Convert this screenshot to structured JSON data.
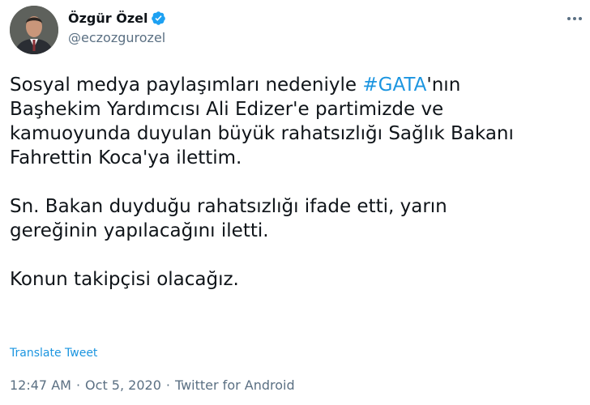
{
  "author": {
    "name": "Özgür Özel",
    "handle": "@eczozgurozel",
    "verified": true
  },
  "body": {
    "line1_before": "Sosyal medya paylaşımları nedeniyle ",
    "hashtag": "#GATA",
    "line1_after": "'nın",
    "line2": "Başhekim Yardımcısı Ali Edizer'e partimizde ve",
    "line3": "kamuoyunda duyulan büyük rahatsızlığı Sağlık Bakanı",
    "line4": "Fahrettin Koca'ya ilettim.",
    "line5": "Sn. Bakan duyduğu rahatsızlığı ifade etti, yarın",
    "line6": "gereğinin yapılacağını iletti.",
    "line7": "Konun takipçisi olacağız."
  },
  "translate_label": "Translate Tweet",
  "meta": {
    "time": "12:47 AM",
    "sep1": "·",
    "date": "Oct 5, 2020",
    "sep2": "·",
    "source": "Twitter for Android"
  },
  "colors": {
    "link": "#1b95e0",
    "muted": "#5b7083",
    "text": "#0f1419",
    "verified": "#1da1f2"
  },
  "icons": {
    "verified": "verified-badge-icon",
    "more": "more-options-icon"
  }
}
